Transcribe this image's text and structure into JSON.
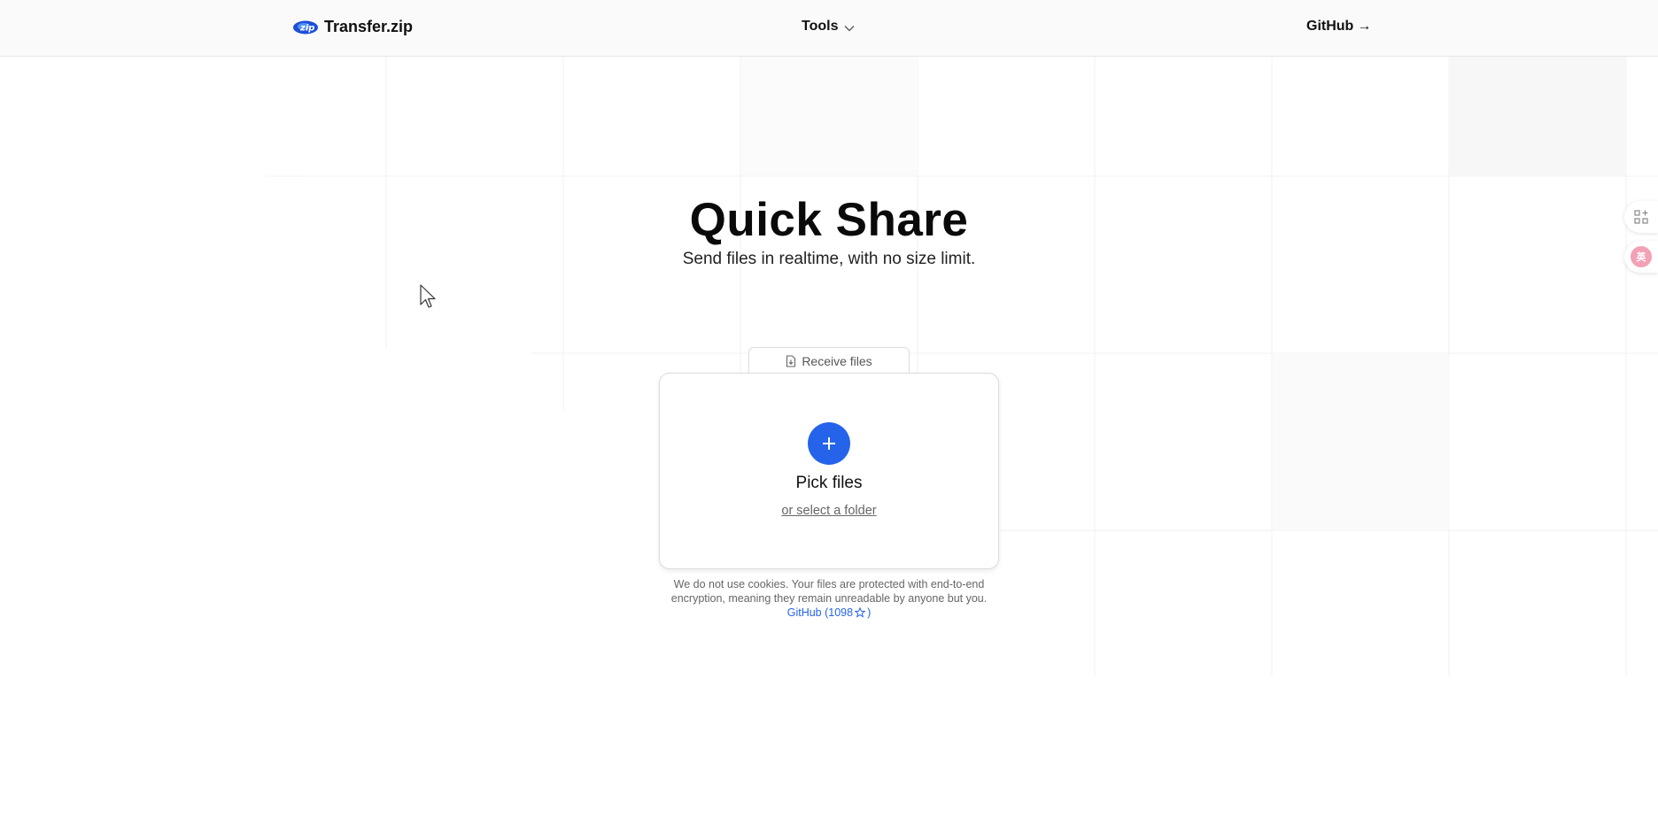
{
  "header": {
    "brand": {
      "logo_icon": "zip-logo-icon",
      "logo_text": "zip",
      "name": "Transfer.zip"
    },
    "tools_label": "Tools",
    "github_label": "GitHub",
    "github_arrow": "→"
  },
  "hero": {
    "title": "Quick Share",
    "subtitle": "Send files in realtime, with no size limit."
  },
  "receive_tab": {
    "label": "Receive files",
    "icon": "file-download-icon"
  },
  "upload_card": {
    "plus_symbol": "+",
    "pick_label": "Pick files",
    "folder_link": "or select a folder"
  },
  "privacy": {
    "line1": "We do not use cookies. Your files are protected with end-to-end",
    "line2": "encryption, meaning they remain unreadable by anyone but you.",
    "github_link": "GitHub (1098",
    "github_link_close": ")"
  },
  "side_widgets": {
    "apps_icon": "apps-add-icon",
    "translate_icon": "translate-icon",
    "translate_text": "英"
  },
  "colors": {
    "accent": "#2563eb",
    "header_bg": "#fafafa",
    "translate_pink": "#f3a1b5"
  }
}
